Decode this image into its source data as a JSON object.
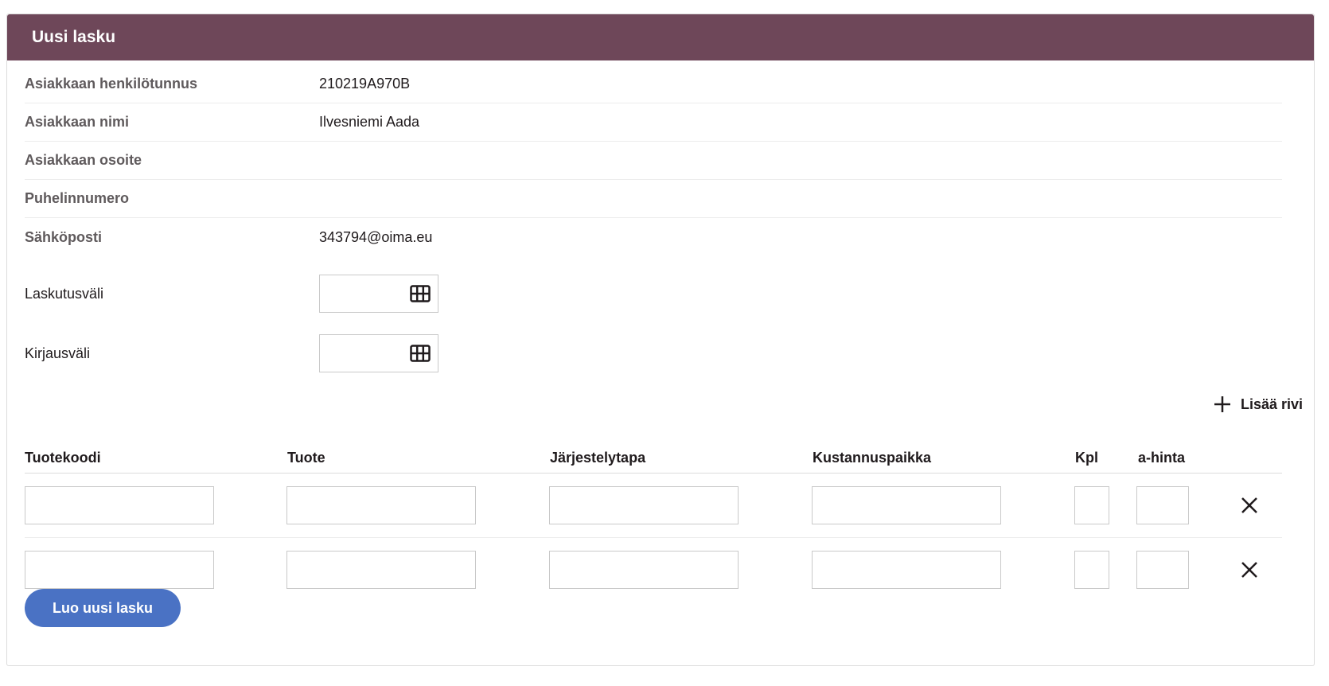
{
  "header": {
    "title": "Uusi lasku"
  },
  "customer": [
    {
      "label": "Asiakkaan henkilötunnus",
      "value": "210219A970B"
    },
    {
      "label": "Asiakkaan nimi",
      "value": "Ilvesniemi Aada"
    },
    {
      "label": "Asiakkaan osoite",
      "value": ""
    },
    {
      "label": "Puhelinnumero",
      "value": ""
    },
    {
      "label": "Sähköposti",
      "value": "343794@oima.eu"
    }
  ],
  "fields": {
    "billing_period": {
      "label": "Laskutusväli",
      "value": "",
      "icon": "calendar-icon"
    },
    "posting_period": {
      "label": "Kirjausväli",
      "value": "",
      "icon": "calendar-icon"
    }
  },
  "add_row": {
    "label": "Lisää rivi",
    "icon": "plus-icon"
  },
  "table": {
    "columns": [
      "Tuotekoodi",
      "Tuote",
      "Järjestelytapa",
      "Kustannuspaikka",
      "Kpl",
      "a-hinta"
    ],
    "rows": [
      {
        "tuotekoodi": "",
        "tuote": "",
        "jarjestelytapa": "",
        "kustannuspaikka": "",
        "kpl": "",
        "ahinta": ""
      },
      {
        "tuotekoodi": "",
        "tuote": "",
        "jarjestelytapa": "",
        "kustannuspaikka": "",
        "kpl": "",
        "ahinta": ""
      }
    ],
    "remove_icon": "close-icon"
  },
  "submit": {
    "label": "Luo uusi lasku"
  },
  "colors": {
    "header_bg": "#6e4759",
    "button_bg": "#4a72c4",
    "label_gray": "#5f5a5c"
  }
}
